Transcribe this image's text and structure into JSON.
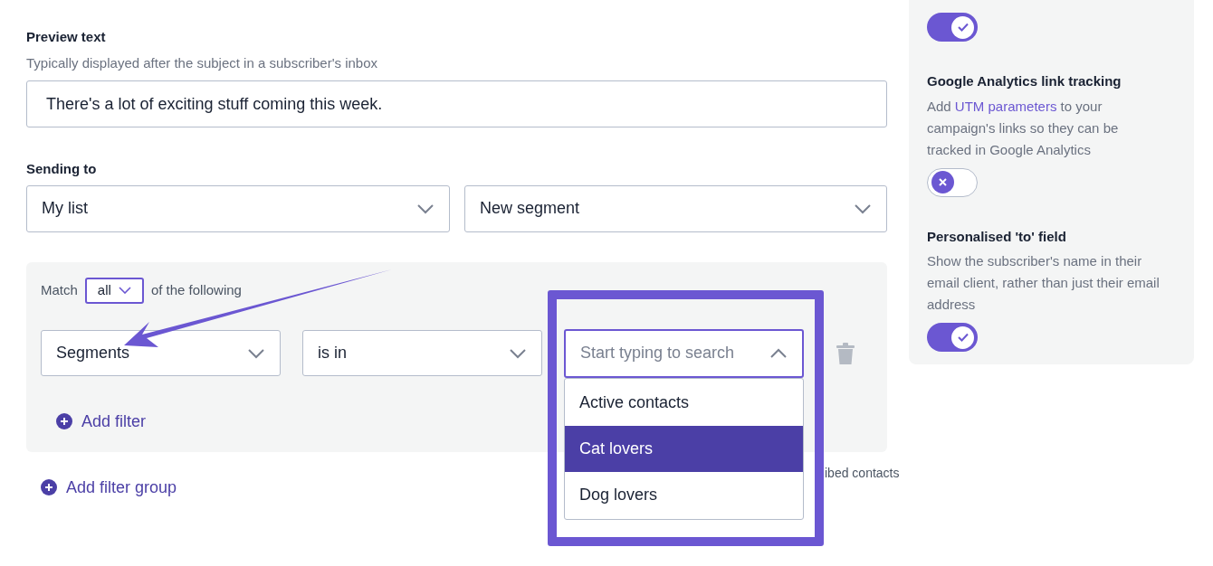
{
  "preview_text": {
    "label": "Preview text",
    "hint": "Typically displayed after the subject in a subscriber's inbox",
    "value": "There's a lot of exciting stuff coming this week."
  },
  "sending_to": {
    "label": "Sending to",
    "list": "My list",
    "segment": "New segment"
  },
  "filter_group": {
    "match_label": "Match",
    "match_value": "all",
    "match_suffix": "of the following",
    "filters": [
      {
        "field": "Segments",
        "operator": "is in",
        "search_placeholder": "Start typing to search",
        "expanded": true
      }
    ],
    "add_filter": "Add filter"
  },
  "dropdown_options": [
    {
      "label": "Active contacts",
      "selected": false
    },
    {
      "label": "Cat lovers",
      "selected": true
    },
    {
      "label": "Dog lovers",
      "selected": false
    }
  ],
  "partial_note": "ibed contacts",
  "add_filter_group": "Add filter group",
  "settings": [
    {
      "on": true
    },
    {
      "title": "Google Analytics link tracking",
      "description": [
        {
          "text": "Add "
        },
        {
          "text": "UTM parameters",
          "kind": "link"
        },
        {
          "text": " to your campaign's links so they can be tracked in Google Analytics"
        }
      ],
      "on": false
    },
    {
      "title": "Personalised 'to' field",
      "description": [
        {
          "text": "Show the subscriber's name in their email client, rather than just their email address"
        }
      ],
      "on": true
    }
  ]
}
